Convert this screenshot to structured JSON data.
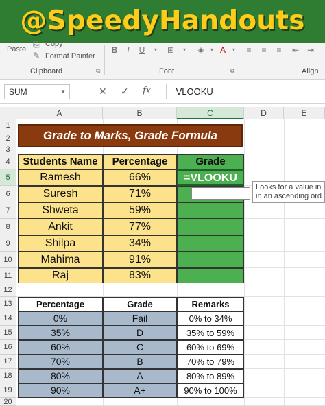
{
  "banner": {
    "text": "@SpeedyHandouts",
    "bg_color": "#2f7d32",
    "text_color": "#ffcc1a"
  },
  "ribbon": {
    "paste_label": "Paste",
    "copy_label": "Copy",
    "format_painter_label": "Format Painter",
    "clipboard_group": "Clipboard",
    "font_group": "Font",
    "alignment_group": "Align",
    "bold": "B",
    "italic": "I",
    "underline": "U"
  },
  "formula_bar": {
    "name_box": "SUM",
    "cancel_icon": "✕",
    "enter_icon": "✓",
    "fx_label": "fx",
    "formula": "=VLOOKU"
  },
  "columns": [
    "A",
    "B",
    "C",
    "D",
    "E"
  ],
  "rows": [
    "1",
    "2",
    "3",
    "4",
    "5",
    "6",
    "7",
    "8",
    "9",
    "10",
    "11",
    "12",
    "13",
    "14",
    "15",
    "16",
    "17",
    "18",
    "19",
    "20"
  ],
  "title": "Grade to Marks, Grade Formula",
  "table1": {
    "headers": [
      "Students Name",
      "Percentage",
      "Grade"
    ],
    "rows": [
      {
        "name": "Ramesh",
        "pct": "66%",
        "grade": "=VLOOKU"
      },
      {
        "name": "Suresh",
        "pct": "71%",
        "grade": ""
      },
      {
        "name": "Shweta",
        "pct": "59%",
        "grade": ""
      },
      {
        "name": "Ankit",
        "pct": "77%",
        "grade": ""
      },
      {
        "name": "Shilpa",
        "pct": "34%",
        "grade": ""
      },
      {
        "name": "Mahima",
        "pct": "91%",
        "grade": ""
      },
      {
        "name": "Raj",
        "pct": "83%",
        "grade": ""
      }
    ]
  },
  "table2": {
    "headers": [
      "Percentage",
      "Grade",
      "Remarks"
    ],
    "rows": [
      {
        "pct": "0%",
        "grade": "Fail",
        "remark": "0% to 34%"
      },
      {
        "pct": "35%",
        "grade": "D",
        "remark": "35% to 59%"
      },
      {
        "pct": "60%",
        "grade": "C",
        "remark": "60% to 69%"
      },
      {
        "pct": "70%",
        "grade": "B",
        "remark": "70% to 79%"
      },
      {
        "pct": "80%",
        "grade": "A",
        "remark": "80% to 89%"
      },
      {
        "pct": "90%",
        "grade": "A+",
        "remark": "90% to 100%"
      }
    ]
  },
  "tooltip": {
    "line1": "Looks for a value in",
    "line2": "in an ascending ord"
  }
}
